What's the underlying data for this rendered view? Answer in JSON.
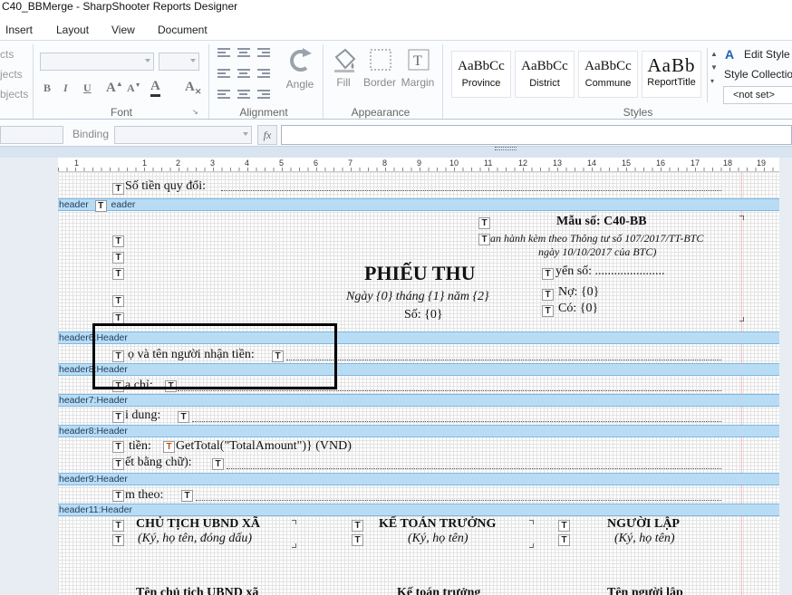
{
  "window": {
    "title": "C40_BBMerge - SharpShooter Reports Designer"
  },
  "menu": [
    "Insert",
    "Layout",
    "View",
    "Document"
  ],
  "ribbon": {
    "left_items": [
      "cts",
      "jects",
      "bjects"
    ],
    "groups": {
      "font": "Font",
      "alignment": "Alignment",
      "appearance": "Appearance",
      "styles": "Styles"
    },
    "angle": "Angle",
    "fill": "Fill",
    "border": "Border",
    "margin": "Margin",
    "styles_gallery": [
      {
        "sample": "AaBbCc",
        "name": "Province"
      },
      {
        "sample": "AaBbCc",
        "name": "District"
      },
      {
        "sample": "AaBbCc",
        "name": "Commune"
      },
      {
        "sample": "AaBb",
        "name": "ReportTitle"
      }
    ],
    "edit_style": "Edit Style",
    "style_collection": "Style Collection",
    "not_set": "<not set>"
  },
  "formula": {
    "binding": "Binding",
    "fx": "fx",
    "value": ""
  },
  "ruler": [
    "1",
    "1",
    "2",
    "3",
    "4",
    "5",
    "6",
    "7",
    "8",
    "9",
    "10",
    "11",
    "12",
    "13",
    "14",
    "15",
    "16",
    "17",
    "18",
    "19"
  ],
  "report": {
    "top_line": "Số tiền quy đổi: ",
    "bands": {
      "b1": "header",
      "b2": "header6:Header",
      "b3": "header8:Header",
      "b4": "header7:Header",
      "b5": "header8:Header",
      "b6": "header9:Header",
      "b7": "header11:Header"
    },
    "band1_tail": "eader",
    "form_code": "Mẫu số: C40-BB",
    "form_note1": "an hành kèm theo Thông tư số 107/2017/TT-BTC",
    "form_note2": "ngày 10/10/2017 của BTC)",
    "title": "PHIẾU THU",
    "date_line": "Ngày {0} tháng {1} năm {2}",
    "number_line": "Số: {0}",
    "quyen_so": "yển số: ......................",
    "no": "Nợ: {0}",
    "co": "Có: {0}",
    "receiver": "ọ và tên người nhận tiền: ",
    "address": "a chỉ: ",
    "content": "i dung: ",
    "amount_prefix": "tiền: ",
    "amount_expr": "GetTotal(\"TotalAmount\")} (VND)",
    "in_words": "ết bằng chữ): ",
    "attached": "m theo: ",
    "sig1_title": "CHỦ TỊCH UBND XÃ",
    "sig1_note": "(Ký, họ tên, đóng dấu)",
    "sig2_title": "KẾ TOÁN TRƯỞNG",
    "sig2_note": "(Ký, họ tên)",
    "sig3_title": "NGƯỜI LẬP",
    "sig3_note": "(Ký, họ tên)",
    "bottom1": "Tên chủ tịch UBND xã",
    "bottom2": "Kế toán trưởng",
    "bottom3": "Tên người lập",
    "textbox_glyph": "T"
  }
}
